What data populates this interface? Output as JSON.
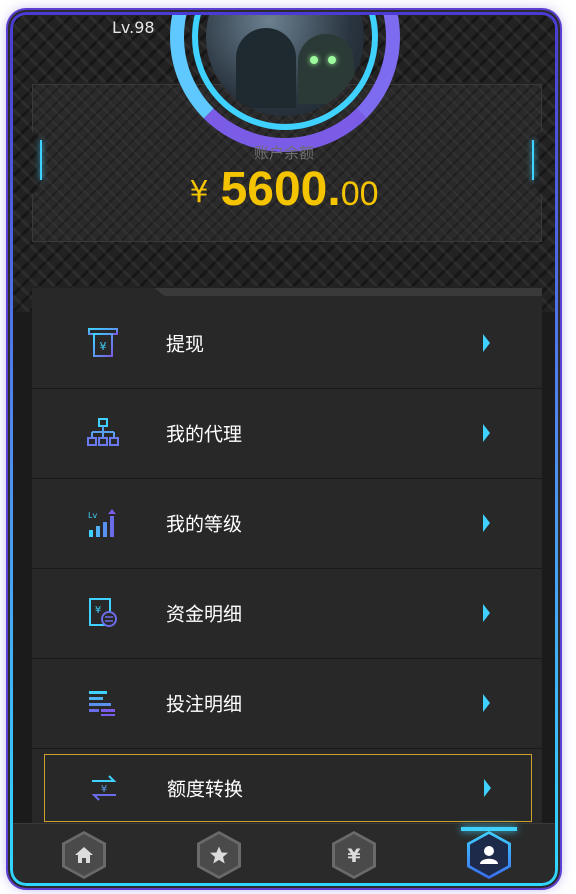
{
  "header": {
    "level_text": "Lv.98",
    "balance_label": "账户余额",
    "currency_symbol": "¥",
    "balance_integer": "5600.",
    "balance_decimal": "00"
  },
  "menu": {
    "items": [
      {
        "label": "提现",
        "icon": "atm-withdraw-icon"
      },
      {
        "label": "我的代理",
        "icon": "org-chart-icon"
      },
      {
        "label": "我的等级",
        "icon": "level-bars-icon"
      },
      {
        "label": "资金明细",
        "icon": "fund-details-icon"
      },
      {
        "label": "投注明细",
        "icon": "bet-list-icon"
      },
      {
        "label": "额度转换",
        "icon": "currency-exchange-icon",
        "active": true
      }
    ]
  },
  "tabbar": {
    "tabs": [
      {
        "icon": "home-icon"
      },
      {
        "icon": "star-icon"
      },
      {
        "icon": "yen-icon"
      },
      {
        "icon": "user-icon",
        "active": true
      }
    ]
  },
  "colors": {
    "accent_cyan": "#3fd1ff",
    "accent_purple": "#6a5ae6",
    "balance_yellow": "#f5c400",
    "active_border": "#c9a22c"
  }
}
